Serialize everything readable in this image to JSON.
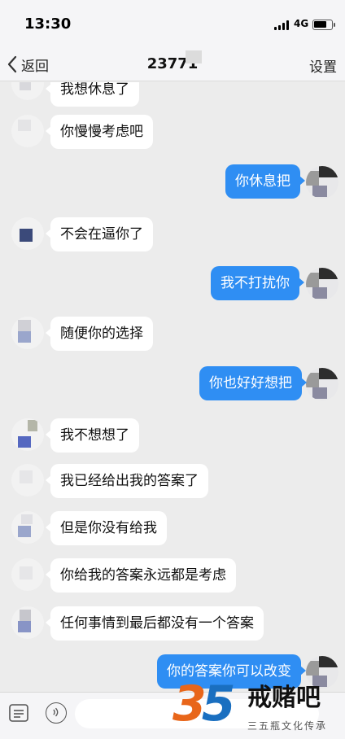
{
  "status_bar": {
    "time": "13:30",
    "network": "4G",
    "battery_level": 0.75
  },
  "nav": {
    "back_label": "返回",
    "title": "23771",
    "settings_label": "设置"
  },
  "messages": [
    {
      "side": "in",
      "text": "我想休息了"
    },
    {
      "side": "in",
      "text": "你慢慢考虑吧"
    },
    {
      "side": "out",
      "text": "你休息把"
    },
    {
      "side": "in",
      "text": "不会在逼你了"
    },
    {
      "side": "out",
      "text": "我不打扰你"
    },
    {
      "side": "in",
      "text": "随便你的选择"
    },
    {
      "side": "out",
      "text": "你也好好想把"
    },
    {
      "side": "in",
      "text": "我不想想了"
    },
    {
      "side": "in",
      "text": "我已经给出我的答案了"
    },
    {
      "side": "in",
      "text": "但是你没有给我"
    },
    {
      "side": "in",
      "text": "你给我的答案永远都是考虑"
    },
    {
      "side": "in",
      "text": "任何事情到最后都没有一个答案"
    },
    {
      "side": "out",
      "text": "你的答案你可以改变"
    }
  ],
  "watermark": {
    "number_left": "3",
    "number_right": "5",
    "name": "戒赌吧",
    "tagline": "三五瓶文化传承"
  },
  "colors": {
    "outgoing_bubble": "#2f8ef3",
    "incoming_bubble": "#ffffff",
    "background": "#ececec"
  },
  "icons": {
    "back": "chevron-left-icon",
    "keyboard": "keyboard-icon",
    "voice": "voice-icon"
  }
}
